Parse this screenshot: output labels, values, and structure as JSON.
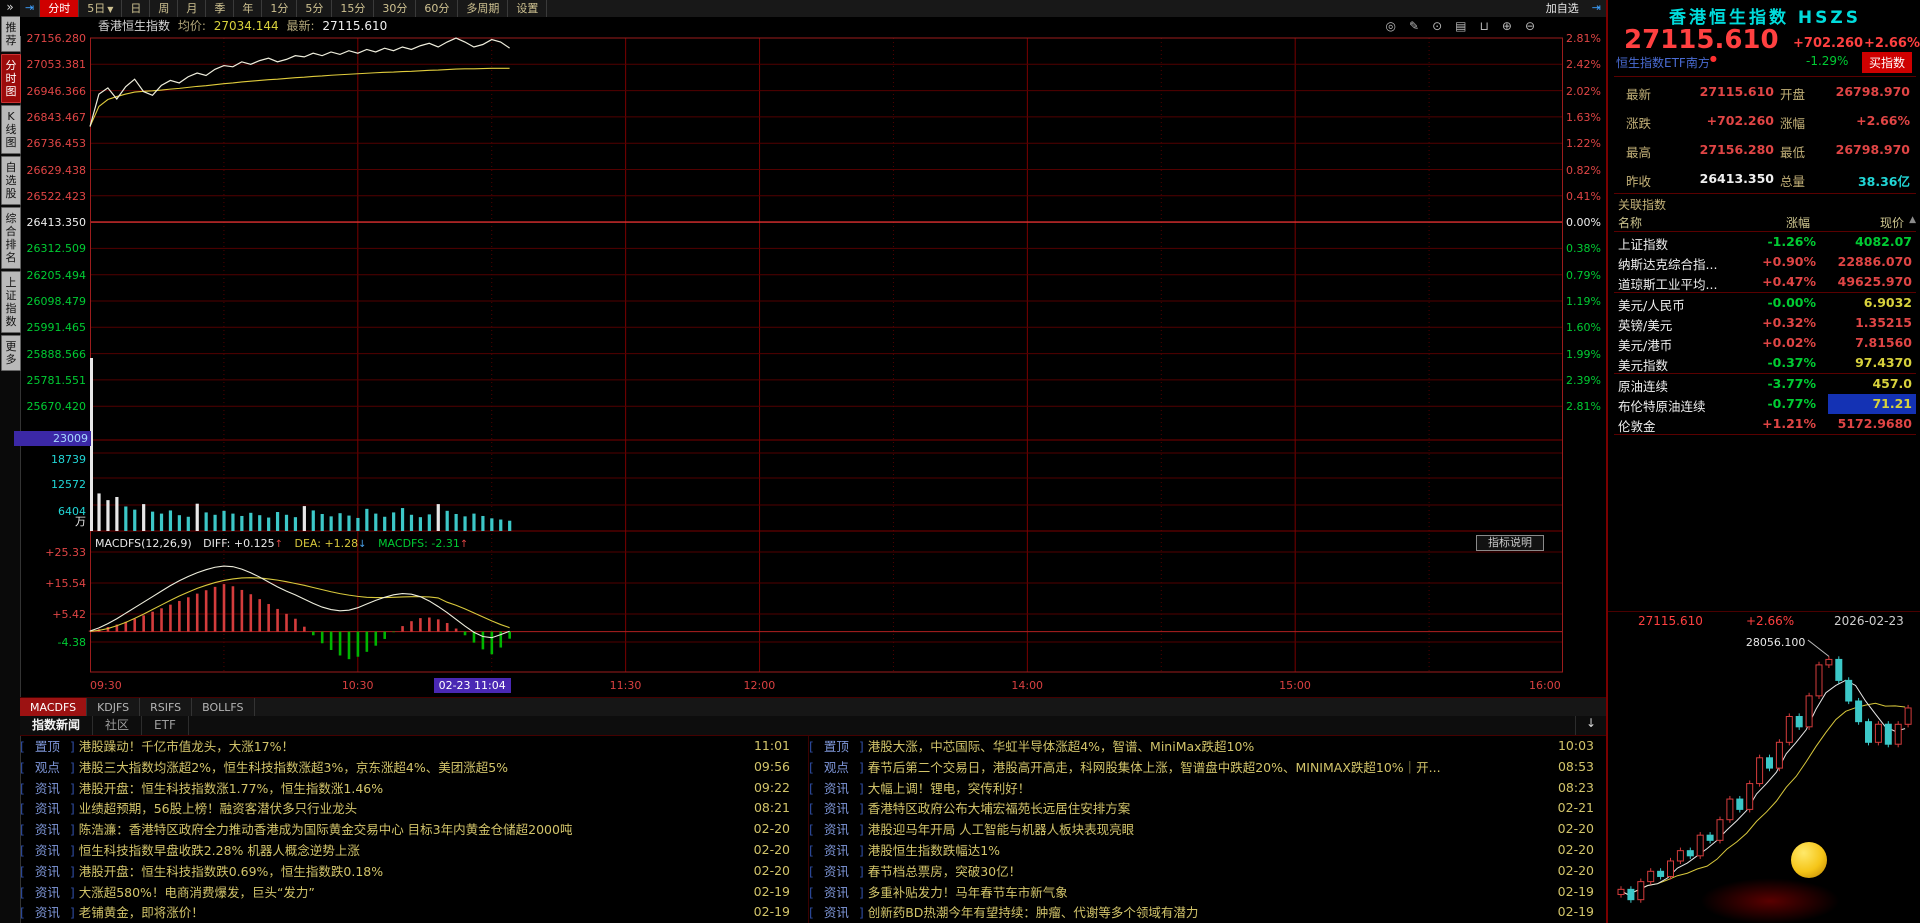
{
  "colors": {
    "up": "#e04545",
    "down": "#00cc33",
    "axis_up": "#d84040",
    "axis_down": "#00cc33",
    "flat": "#efefef",
    "grid": "#520000",
    "grid_bright": "#7a0000",
    "frame": "#9b1c1c",
    "prev_close_line": "#e03030",
    "price_line": "#efeedd",
    "avg_line": "#e0cc3c",
    "volume_bar": "#3cc8c8",
    "volume_bar_hi": "#e8e8e8",
    "macd_red": "#d43c3c",
    "macd_green": "#00b400",
    "dif_line": "#eeeedd",
    "dea_line": "#d8c83c"
  },
  "toolbar": {
    "jump_icon": "⇥",
    "items": [
      "分时",
      "5日",
      "日",
      "周",
      "月",
      "季",
      "年",
      "1分",
      "5分",
      "15分",
      "30分",
      "60分",
      "多周期",
      "设置"
    ],
    "selected": "分时",
    "dropdown_item": "5日",
    "caret": "▼",
    "add_watchlist": "加自选",
    "arrow_icon": "⇥"
  },
  "sidebar": {
    "collapse_icon": "»",
    "items": [
      {
        "label": "推荐",
        "sel": false
      },
      {
        "label": "分时图",
        "sel": true
      },
      {
        "label": "K线图",
        "sel": false
      },
      {
        "label": "自选股",
        "sel": false
      },
      {
        "label": "综合排名",
        "sel": false
      },
      {
        "label": "上证指数",
        "sel": false
      },
      {
        "label": "更多",
        "sel": false
      }
    ]
  },
  "chart_header": {
    "name": "香港恒生指数",
    "avg_label": "均价:",
    "avg": "27034.144",
    "last_label": "最新:",
    "last": "27115.610",
    "icons": [
      {
        "name": "settings-icon",
        "glyph": "◎"
      },
      {
        "name": "draw-icon",
        "glyph": "✎"
      },
      {
        "name": "eye-icon",
        "glyph": "⊙"
      },
      {
        "name": "print-icon",
        "glyph": "▤"
      },
      {
        "name": "lock-icon",
        "glyph": "⊔"
      },
      {
        "name": "zoom-in-icon",
        "glyph": "⊕"
      },
      {
        "name": "zoom-out-icon",
        "glyph": "⊖"
      }
    ]
  },
  "macd_header": {
    "name": "MACDFS(12,26,9)",
    "diff": "DIFF: +0.125",
    "diff_arrow": "↑",
    "dea": "DEA: +1.28",
    "dea_arrow": "↓",
    "macd": "MACDFS: -2.31",
    "macd_arrow": "↑",
    "help": "指标说明"
  },
  "indicator_tabs": {
    "items": [
      "MACDFS",
      "KDJFS",
      "RSIFS",
      "BOLLFS"
    ],
    "selected": "MACDFS"
  },
  "news_tabs": {
    "items": [
      "指数新闻",
      "社区",
      "ETF"
    ],
    "selected": "指数新闻",
    "download_icon": "↓"
  },
  "news": {
    "left": [
      {
        "tag": "置顶",
        "title": "港股躁动！千亿市值龙头，大涨17%！",
        "time": "11:01"
      },
      {
        "tag": "观点",
        "title": "港股三大指数均涨超2%，恒生科技指数涨超3%，京东涨超4%、美团涨超5%",
        "time": "09:56"
      },
      {
        "tag": "资讯",
        "title": "港股开盘：恒生科技指数涨1.77%，恒生指数涨1.46%",
        "time": "09:22"
      },
      {
        "tag": "资讯",
        "title": "业绩超预期，56股上榜！融资客潜伏多只行业龙头",
        "time": "08:21"
      },
      {
        "tag": "资讯",
        "title": "陈浩濂：香港特区政府全力推动香港成为国际黄金交易中心 目标3年内黄金仓储超2000吨",
        "time": "02-20"
      },
      {
        "tag": "资讯",
        "title": "恒生科技指数早盘收跌2.28% 机器人概念逆势上涨",
        "time": "02-20"
      },
      {
        "tag": "资讯",
        "title": "港股开盘：恒生科技指数跌0.69%，恒生指数跌0.18%",
        "time": "02-20"
      },
      {
        "tag": "资讯",
        "title": "大涨超580%！电商消费爆发，巨头“发力”",
        "time": "02-19"
      },
      {
        "tag": "资讯",
        "title": "老铺黄金，即将涨价！",
        "time": "02-19"
      }
    ],
    "right": [
      {
        "tag": "置顶",
        "title": "港股大涨，中芯国际、华虹半导体涨超4%，智谱、MiniMax跌超10%",
        "time": "10:03"
      },
      {
        "tag": "观点",
        "title": "春节后第二个交易日，港股高开高走，科网股集体上涨，智谱盘中跌超20%、MINIMAX跌超10%｜开...",
        "time": "08:53"
      },
      {
        "tag": "资讯",
        "title": "大幅上调！锂电，突传利好！",
        "time": "08:23"
      },
      {
        "tag": "资讯",
        "title": "香港特区政府公布大埔宏福苑长远居住安排方案",
        "time": "02-21"
      },
      {
        "tag": "资讯",
        "title": "港股迎马年开局 人工智能与机器人板块表现亮眼",
        "time": "02-20"
      },
      {
        "tag": "资讯",
        "title": "港股恒生指数跌幅达1%",
        "time": "02-20"
      },
      {
        "tag": "资讯",
        "title": "春节档总票房，突破30亿！",
        "time": "02-20"
      },
      {
        "tag": "资讯",
        "title": "多重补贴发力！马年春节车市新气象",
        "time": "02-19"
      },
      {
        "tag": "资讯",
        "title": "创新药BD热潮今年有望持续：肿瘤、代谢等多个领域有潜力",
        "time": "02-19"
      }
    ]
  },
  "right_panel": {
    "title": "香港恒生指数 HSZS",
    "price": "27115.610",
    "change": "+702.260",
    "pct": "+2.66%",
    "etf": {
      "name": "恒生指数ETF南方",
      "dot": "●",
      "pct": "-1.29%",
      "buy": "买指数"
    },
    "quotes": [
      {
        "l": "最新",
        "v": "27115.610",
        "c": "up"
      },
      {
        "l": "开盘",
        "v": "26798.970",
        "c": "up"
      },
      {
        "l": "涨跌",
        "v": "+702.260",
        "c": "up"
      },
      {
        "l": "涨幅",
        "v": "+2.66%",
        "c": "up"
      },
      {
        "l": "最高",
        "v": "27156.280",
        "c": "up"
      },
      {
        "l": "最低",
        "v": "26798.970",
        "c": "up"
      },
      {
        "l": "昨收",
        "v": "26413.350",
        "c": "flat"
      },
      {
        "l": "总量",
        "v": "38.36亿",
        "c": "cyan"
      }
    ],
    "related_title": "关联指数",
    "scroll_icon": "▲",
    "related_header": {
      "name": "名称",
      "chg": "涨幅",
      "price": "现价"
    },
    "related": [
      {
        "name": "上证指数",
        "chg": "-1.26%",
        "price": "4082.07",
        "cc": "down",
        "pc": "down",
        "g": 0
      },
      {
        "name": "纳斯达克综合指...",
        "chg": "+0.90%",
        "price": "22886.070",
        "cc": "up",
        "pc": "up",
        "g": 0
      },
      {
        "name": "道琼斯工业平均...",
        "chg": "+0.47%",
        "price": "49625.970",
        "cc": "up",
        "pc": "up",
        "g": 0
      },
      {
        "name": "美元/人民币",
        "chg": "-0.00%",
        "price": "6.9032",
        "cc": "down",
        "pc": "yellow",
        "g": 1
      },
      {
        "name": "英镑/美元",
        "chg": "+0.32%",
        "price": "1.35215",
        "cc": "up",
        "pc": "up",
        "g": 1
      },
      {
        "name": "美元/港币",
        "chg": "+0.02%",
        "price": "7.81560",
        "cc": "up",
        "pc": "up",
        "g": 1
      },
      {
        "name": "美元指数",
        "chg": "-0.37%",
        "price": "97.4370",
        "cc": "down",
        "pc": "yellow",
        "g": 1
      },
      {
        "name": "原油连续",
        "chg": "-3.77%",
        "price": "457.0",
        "cc": "down",
        "pc": "yellow",
        "g": 2
      },
      {
        "name": "布伦特原油连续",
        "chg": "-0.77%",
        "price": "71.21",
        "cc": "down",
        "pc": "yellow",
        "hl": true,
        "g": 2
      },
      {
        "name": "伦敦金",
        "chg": "+1.21%",
        "price": "5172.9680",
        "cc": "up",
        "pc": "up",
        "g": 2
      }
    ],
    "mini": {
      "price": "27115.610",
      "pct": "+2.66%",
      "date": "2026-02-23"
    }
  },
  "chart_data": [
    {
      "type": "line",
      "title": "香港恒生指数 分时图",
      "x_start_min": 0,
      "x_step_min": 2,
      "session_total_min": 330,
      "open": 26798.97,
      "high": 27156.28,
      "low": 26798.97,
      "last": 27115.61,
      "prev_close": 26413.35,
      "avg_price_last": 27034.144,
      "turnover": "38.36亿",
      "y_axis_left": [
        "27156.280",
        "27053.381",
        "26946.366",
        "26843.467",
        "26736.453",
        "26629.438",
        "26522.423",
        "26413.350",
        "26312.509",
        "26205.494",
        "26098.479",
        "25991.465",
        "25888.566",
        "25781.551",
        "25670.420"
      ],
      "y_axis_right_pct": [
        "2.81%",
        "2.42%",
        "2.02%",
        "1.63%",
        "1.22%",
        "0.82%",
        "0.41%",
        "0.00%",
        "0.38%",
        "0.79%",
        "1.19%",
        "1.60%",
        "1.99%",
        "2.39%",
        "2.81%"
      ],
      "time_ticks": [
        {
          "label": "09:30",
          "min": 0
        },
        {
          "label": "10:30",
          "min": 60
        },
        {
          "label": "11:30",
          "min": 120
        },
        {
          "label": "12:00",
          "min": 150
        },
        {
          "label": "14:00",
          "min": 210
        },
        {
          "label": "15:00",
          "min": 270
        },
        {
          "label": "16:00",
          "min": 330
        }
      ],
      "crosshair": {
        "label": "02-23 11:04",
        "min": 94,
        "volume_label": "23009"
      },
      "price": [
        26799,
        26930,
        26955,
        26910,
        26960,
        26990,
        26940,
        26925,
        26965,
        26985,
        26975,
        27000,
        27015,
        27005,
        27030,
        27045,
        27040,
        27060,
        27050,
        27065,
        27075,
        27060,
        27070,
        27085,
        27080,
        27095,
        27085,
        27100,
        27090,
        27105,
        27095,
        27110,
        27100,
        27115,
        27105,
        27120,
        27110,
        27125,
        27135,
        27120,
        27140,
        27156,
        27140,
        27120,
        27130,
        27150,
        27140,
        27115.6
      ],
      "avg": [
        26799,
        26880,
        26908,
        26920,
        26930,
        26938,
        26941,
        26943,
        26946,
        26950,
        26953,
        26957,
        26961,
        26964,
        26968,
        26972,
        26975,
        26979,
        26982,
        26985,
        26988,
        26990,
        26993,
        26996,
        26998,
        27001,
        27003,
        27006,
        27008,
        27010,
        27012,
        27014,
        27016,
        27018,
        27019,
        27021,
        27022,
        27024,
        27026,
        27027,
        27029,
        27031,
        27032,
        27032,
        27033,
        27034,
        27034,
        27034.144
      ],
      "volume_wan": [
        23009,
        9500,
        7800,
        8600,
        6200,
        5400,
        6800,
        4900,
        4400,
        5200,
        4000,
        3600,
        6900,
        4700,
        4100,
        5100,
        4400,
        3800,
        4600,
        4000,
        3400,
        4800,
        4100,
        3500,
        6300,
        5200,
        4300,
        3700,
        4500,
        3900,
        3300,
        5600,
        4400,
        3600,
        4700,
        5800,
        4100,
        3500,
        4200,
        6800,
        5100,
        4300,
        3700,
        4400,
        3800,
        3200,
        2900,
        2600
      ],
      "volume_axis": {
        "max_label": "23009",
        "labels": [
          "18739",
          "12572",
          "6404"
        ],
        "unit": "万"
      },
      "macd": {
        "scale": [
          "+25.33",
          "+15.54",
          "+5.42",
          "-4.38"
        ],
        "hist": [
          0.3,
          0.8,
          1.5,
          2.3,
          3.2,
          4.2,
          5.3,
          6.5,
          7.6,
          8.8,
          10,
          11.2,
          12.4,
          13.5,
          14.6,
          15.5,
          14.8,
          13.6,
          12.2,
          10.6,
          9,
          7.4,
          5.8,
          4.2,
          1.6,
          -1.2,
          -3.8,
          -6,
          -7.8,
          -9,
          -8.2,
          -6.6,
          -4.6,
          -2.4,
          -0.2,
          1.8,
          3.4,
          4.4,
          4.6,
          4,
          2.8,
          1,
          -1.2,
          -3.6,
          -5.8,
          -7.4,
          -5.2,
          -2.31
        ],
        "dif": [
          0.2,
          1.2,
          2.6,
          4.2,
          6,
          7.8,
          9.6,
          11.4,
          13.2,
          15,
          16.6,
          18,
          19.2,
          20.2,
          21,
          21.4,
          21.2,
          20.4,
          19.2,
          17.8,
          16.2,
          14.6,
          13.2,
          12,
          10.6,
          9.2,
          8,
          7.2,
          6.8,
          7,
          7.8,
          9,
          10.2,
          11.2,
          12,
          12.4,
          12.2,
          11.4,
          10,
          8.2,
          6.2,
          4,
          1.8,
          -0.2,
          -1.6,
          -2,
          -1,
          0.125
        ],
        "dea": [
          0.1,
          0.4,
          1,
          1.9,
          3,
          4.3,
          5.7,
          7.2,
          8.7,
          10.2,
          11.6,
          12.9,
          14.1,
          15.1,
          16,
          16.7,
          17.2,
          17.5,
          17.6,
          17.5,
          17.2,
          16.8,
          16.3,
          15.7,
          15.1,
          14.4,
          13.7,
          13,
          12.4,
          11.9,
          11.5,
          11.2,
          11.1,
          11.1,
          11.2,
          11.3,
          11.4,
          11.4,
          11.3,
          11,
          9.6,
          8.6,
          7.4,
          6.1,
          4.8,
          3.5,
          2.3,
          1.28
        ]
      }
    },
    {
      "type": "candlestick",
      "title": "日K缩略图",
      "closes": [
        23600,
        23400,
        23750,
        23950,
        23850,
        24150,
        24350,
        24250,
        24650,
        24550,
        24950,
        25350,
        25150,
        25650,
        26150,
        25950,
        26450,
        26950,
        26750,
        27350,
        27950,
        28056.1,
        27650,
        27250,
        26850,
        26450,
        26800,
        26413,
        26799,
        27115.6
      ],
      "annotation": "28056.100",
      "annotation_index": 21,
      "header": {
        "price": "27115.610",
        "pct": "+2.66%",
        "date": "2026-02-23"
      }
    }
  ]
}
